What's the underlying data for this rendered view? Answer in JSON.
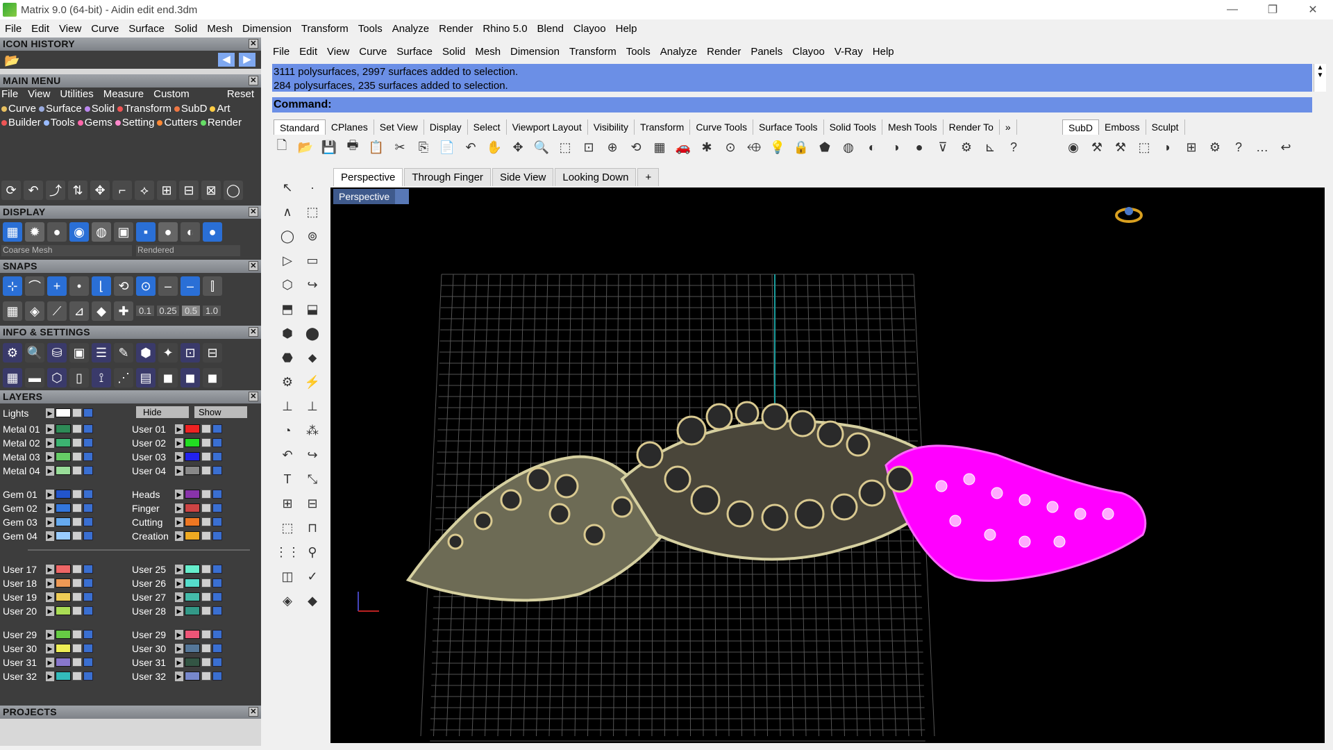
{
  "window": {
    "title": "Matrix 9.0 (64-bit) - Aidin edit end.3dm",
    "controls": [
      "—",
      "❐",
      "✕"
    ]
  },
  "top_menu": [
    "File",
    "Edit",
    "View",
    "Curve",
    "Surface",
    "Solid",
    "Mesh",
    "Dimension",
    "Transform",
    "Tools",
    "Analyze",
    "Render",
    "Rhino 5.0",
    "Blend",
    "Clayoo",
    "Help"
  ],
  "rhino_menu": [
    "File",
    "Edit",
    "View",
    "Curve",
    "Surface",
    "Solid",
    "Mesh",
    "Dimension",
    "Transform",
    "Tools",
    "Analyze",
    "Render",
    "Panels",
    "Clayoo",
    "V-Ray",
    "Help"
  ],
  "panels": {
    "icon_history": "ICON HISTORY",
    "main_menu": "MAIN MENU",
    "main_menu_nav": [
      "File",
      "View",
      "Utilities",
      "Measure",
      "Custom",
      "Reset"
    ],
    "main_menu_cats_1": [
      {
        "label": "Curve",
        "color": "#e8c060"
      },
      {
        "label": "Surface",
        "color": "#9ad"
      },
      {
        "label": "Solid",
        "color": "#b8e"
      },
      {
        "label": "Transform",
        "color": "#e55"
      },
      {
        "label": "SubD",
        "color": "#e74"
      },
      {
        "label": "Art",
        "color": "#fc4"
      }
    ],
    "main_menu_cats_2": [
      {
        "label": "Builder",
        "color": "#e55"
      },
      {
        "label": "Tools",
        "color": "#9bf"
      },
      {
        "label": "Gems",
        "color": "#f6a"
      },
      {
        "label": "Setting",
        "color": "#f8c"
      },
      {
        "label": "Cutters",
        "color": "#f83"
      },
      {
        "label": "Render",
        "color": "#6d6"
      }
    ],
    "display": "DISPLAY",
    "display_modes": [
      "Coarse Mesh",
      "Rendered"
    ],
    "snaps": "SNAPS",
    "snap_values": [
      "0.1",
      "0.25",
      "0.5",
      "1.0"
    ],
    "info_settings": "INFO & SETTINGS",
    "layers": "LAYERS",
    "layers_lights": "Lights",
    "layers_hide": "Hide",
    "layers_show": "Show",
    "projects": "PROJECTS"
  },
  "layers_left": [
    {
      "name": "Metal 01",
      "color": "#2e8b57"
    },
    {
      "name": "Metal 02",
      "color": "#3cb371"
    },
    {
      "name": "Metal 03",
      "color": "#66cc66"
    },
    {
      "name": "Metal 04",
      "color": "#99dd99"
    },
    {
      "name": "Gem 01",
      "color": "#2255cc"
    },
    {
      "name": "Gem 02",
      "color": "#3377dd"
    },
    {
      "name": "Gem 03",
      "color": "#66aaee"
    },
    {
      "name": "Gem 04",
      "color": "#99ccff"
    },
    {
      "name": "User 17",
      "color": "#ee6666"
    },
    {
      "name": "User 18",
      "color": "#ee9955"
    },
    {
      "name": "User 19",
      "color": "#eecc55"
    },
    {
      "name": "User 20",
      "color": "#aadd55"
    },
    {
      "name": "User 29",
      "color": "#66cc44"
    },
    {
      "name": "User 30",
      "color": "#eeee55"
    },
    {
      "name": "User 31",
      "color": "#8877cc"
    },
    {
      "name": "User 32",
      "color": "#33bbbb"
    }
  ],
  "layers_right": [
    {
      "name": "User 01",
      "color": "#ee2222"
    },
    {
      "name": "User 02",
      "color": "#22dd22"
    },
    {
      "name": "User 03",
      "color": "#2222ee"
    },
    {
      "name": "User 04",
      "color": "#888888"
    },
    {
      "name": "Heads",
      "color": "#8833aa"
    },
    {
      "name": "Finger",
      "color": "#cc4444"
    },
    {
      "name": "Cutting",
      "color": "#ee7722"
    },
    {
      "name": "Creation",
      "color": "#eeaa22"
    },
    {
      "name": "User 25",
      "color": "#66eecc"
    },
    {
      "name": "User 26",
      "color": "#55ddcc"
    },
    {
      "name": "User 27",
      "color": "#44bbaa"
    },
    {
      "name": "User 28",
      "color": "#339988"
    },
    {
      "name": "User 29",
      "color": "#ee5577"
    },
    {
      "name": "User 30",
      "color": "#557799"
    },
    {
      "name": "User 31",
      "color": "#335544"
    },
    {
      "name": "User 32",
      "color": "#7788cc"
    }
  ],
  "command_history": [
    "3111 polysurfaces, 2997 surfaces added to selection.",
    "284 polysurfaces, 235 surfaces added to selection."
  ],
  "command_prompt": "Command:",
  "toolbar_tabs": [
    "Standard",
    "CPlanes",
    "Set View",
    "Display",
    "Select",
    "Viewport Layout",
    "Visibility",
    "Transform",
    "Curve Tools",
    "Surface Tools",
    "Solid Tools",
    "Mesh Tools",
    "Render To"
  ],
  "toolbar_tabs_right": [
    "SubD",
    "Emboss",
    "Sculpt"
  ],
  "viewport_tabs": [
    "Perspective",
    "Through Finger",
    "Side View",
    "Looking Down",
    "+"
  ],
  "viewport_label": "Perspective",
  "colors": {
    "command_bg": "#6b8fe6",
    "accent_magenta": "#ff00ff",
    "viewport_bg": "#000000"
  }
}
